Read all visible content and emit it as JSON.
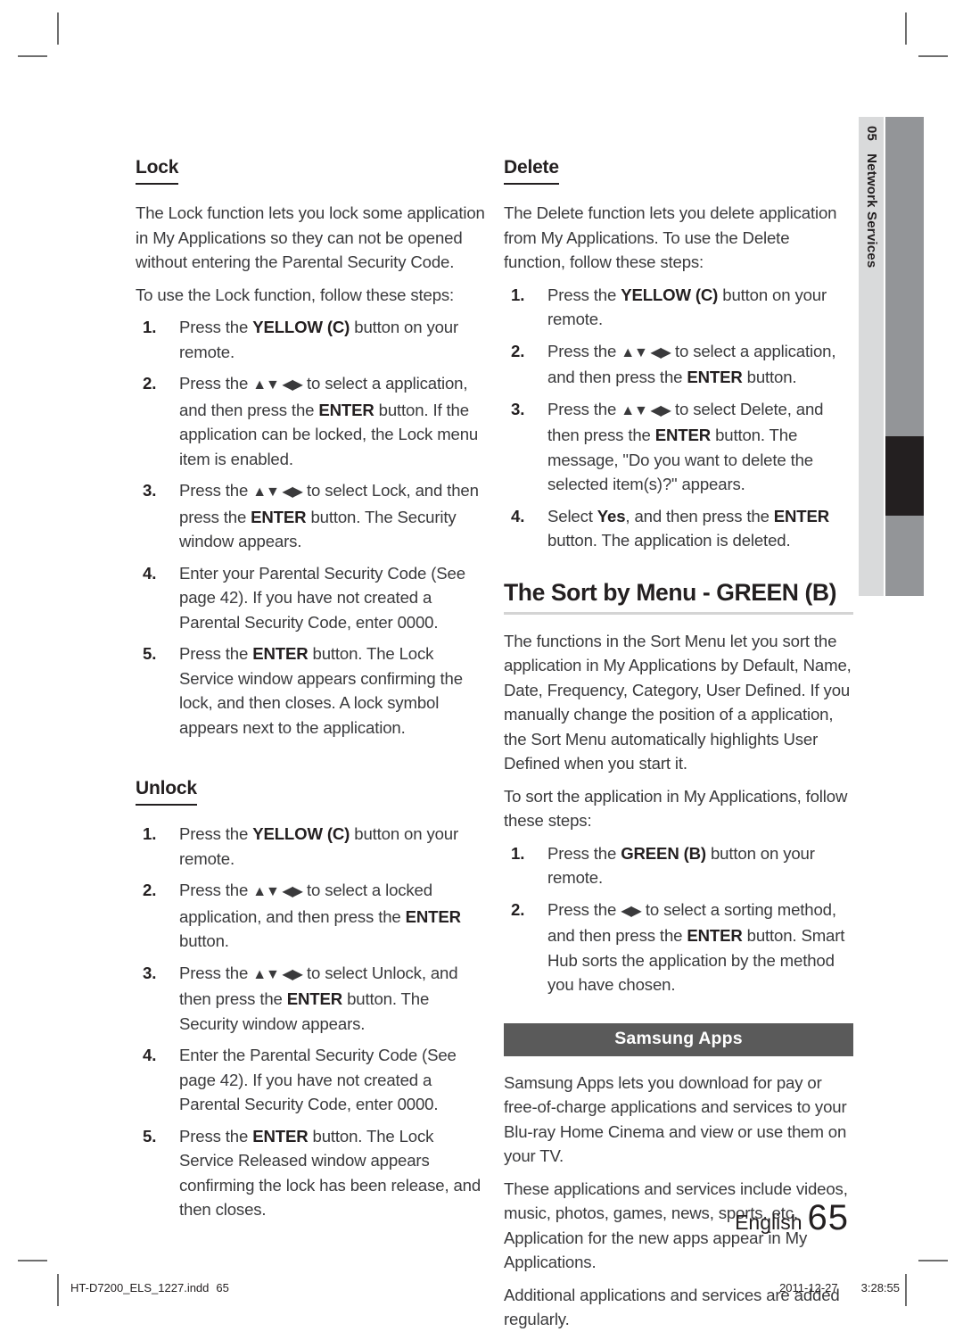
{
  "document": {
    "language_label": "English",
    "page_number": "65",
    "chapter_number": "05",
    "chapter_title": "Network Services"
  },
  "left_column": {
    "lock": {
      "heading": "Lock",
      "intro": "The Lock function lets you lock some application in My Applications so they can not be opened without entering the Parental Security Code.",
      "lead": "To use the Lock function, follow these steps:",
      "steps": [
        {
          "num": "1.",
          "pre": "Press the ",
          "bold": "YELLOW (C)",
          "post": " button on your remote."
        },
        {
          "num": "2.",
          "pre": "Press the ",
          "arrows": "▲▼ ◀▶",
          "mid": " to select a application, and then press the ",
          "bold": "ENTER",
          "post": " button. If the application can be locked, the Lock menu item is enabled."
        },
        {
          "num": "3.",
          "pre": "Press the ",
          "arrows": "▲▼ ◀▶",
          "mid": " to select Lock, and then press the ",
          "bold": "ENTER",
          "post": " button. The Security window appears."
        },
        {
          "num": "4.",
          "pre": "Enter your Parental Security Code (See page 42). If you have not created a Parental Security Code, enter 0000."
        },
        {
          "num": "5.",
          "pre": "Press the ",
          "bold": "ENTER",
          "post": " button. The Lock Service window appears confirming the lock, and then closes. A lock symbol appears next to the application."
        }
      ]
    },
    "unlock": {
      "heading": "Unlock",
      "steps": [
        {
          "num": "1.",
          "pre": "Press the ",
          "bold": "YELLOW (C)",
          "post": " button on your remote."
        },
        {
          "num": "2.",
          "pre": "Press the ",
          "arrows": "▲▼ ◀▶",
          "mid": " to select a locked application, and then press the ",
          "bold": "ENTER",
          "post": " button."
        },
        {
          "num": "3.",
          "pre": "Press the ",
          "arrows": "▲▼ ◀▶",
          "mid": " to select Unlock, and then press the ",
          "bold": "ENTER",
          "post": " button. The Security window appears."
        },
        {
          "num": "4.",
          "pre": "Enter the Parental Security Code (See page 42). If you have not created a Parental Security Code, enter 0000."
        },
        {
          "num": "5.",
          "pre": "Press the ",
          "bold": "ENTER",
          "post": " button. The Lock Service Released window appears confirming the lock has been release, and then closes."
        }
      ]
    }
  },
  "right_column": {
    "delete": {
      "heading": "Delete",
      "intro": "The Delete function lets you delete application from My Applications. To use the Delete function, follow these steps:",
      "steps": [
        {
          "num": "1.",
          "pre": "Press the ",
          "bold": "YELLOW (C)",
          "post": " button on your remote."
        },
        {
          "num": "2.",
          "pre": "Press the ",
          "arrows": "▲▼ ◀▶",
          "mid": " to select a application, and then press the ",
          "bold": "ENTER",
          "post": " button."
        },
        {
          "num": "3.",
          "pre": "Press the ",
          "arrows": "▲▼ ◀▶",
          "mid": " to select Delete, and then press the ",
          "bold": "ENTER",
          "post": " button. The message, \"Do you want to delete the selected item(s)?\" appears."
        },
        {
          "num": "4.",
          "pre": "Select ",
          "bold": "Yes",
          "mid": ", and then press the ",
          "bold2": "ENTER",
          "post": " button. The application is deleted."
        }
      ]
    },
    "sort_by_menu": {
      "heading": "The Sort by Menu - GREEN (B)",
      "intro": "The functions in the Sort Menu let you sort the application in My Applications by Default, Name, Date, Frequency, Category, User Defined. If you manually change the position of a application, the Sort Menu automatically highlights User Defined when you start it.",
      "lead": "To sort the application in My Applications, follow these steps:",
      "steps": [
        {
          "num": "1.",
          "pre": "Press the ",
          "bold": "GREEN (B)",
          "post": " button on your remote."
        },
        {
          "num": "2.",
          "pre": "Press the ",
          "arrows": "◀▶",
          "mid": " to select a sorting method, and then press the ",
          "bold": "ENTER",
          "post": " button. Smart Hub sorts the application by the method you have chosen."
        }
      ]
    },
    "samsung_apps": {
      "banner": "Samsung Apps",
      "paragraphs": [
        "Samsung Apps lets you download for pay or free-of-charge applications and services to your Blu-ray Home Cinema and view or use them on your TV.",
        "These applications and services include videos, music, photos, games, news, sports, etc. Application for the new apps appear in My Applications.",
        "Additional applications and services are added regularly."
      ]
    }
  },
  "print_footer": {
    "file_name": "HT-D7200_ELS_1227.indd",
    "page": "65",
    "date": "2011-12-27",
    "time": "3:28:55"
  },
  "colors": {
    "text": "#231f20",
    "body_text": "#3a3a3c",
    "banner_bg": "#5a5a5a",
    "tab_strip_bg": "#d9dadb",
    "tab_bar_bg": "#939598",
    "tab_bar_active": "#231f20",
    "rule_gray": "#d4d4d4"
  }
}
